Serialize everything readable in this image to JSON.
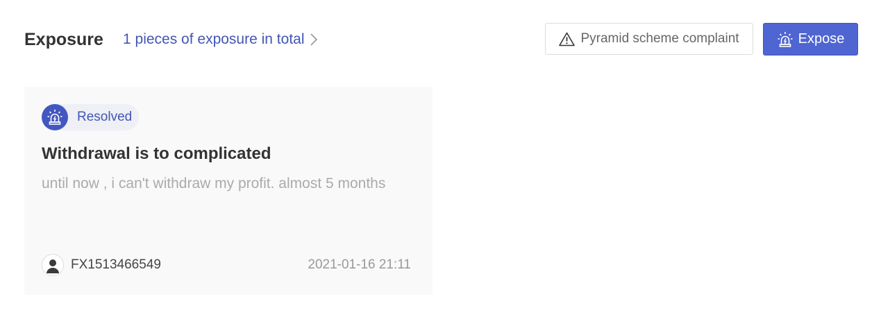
{
  "header": {
    "title": "Exposure",
    "total_link": "1 pieces of exposure in total"
  },
  "actions": {
    "complaint_label": "Pyramid scheme complaint",
    "expose_label": "Expose"
  },
  "card": {
    "status": "Resolved",
    "title": "Withdrawal is to complicated",
    "description": "until now , i can't withdraw my profit. almost 5 months",
    "username": "FX1513466549",
    "timestamp": "2021-01-16 21:11"
  },
  "icons": {
    "chevron": "chevron-right-icon",
    "warning": "warning-triangle-icon",
    "alarm": "alarm-siren-icon",
    "avatar": "user-avatar-icon"
  },
  "colors": {
    "accent": "#4f65d2",
    "link": "#4256b5",
    "card_bg": "#f9f9f9",
    "muted_text": "#aaaaaa"
  }
}
